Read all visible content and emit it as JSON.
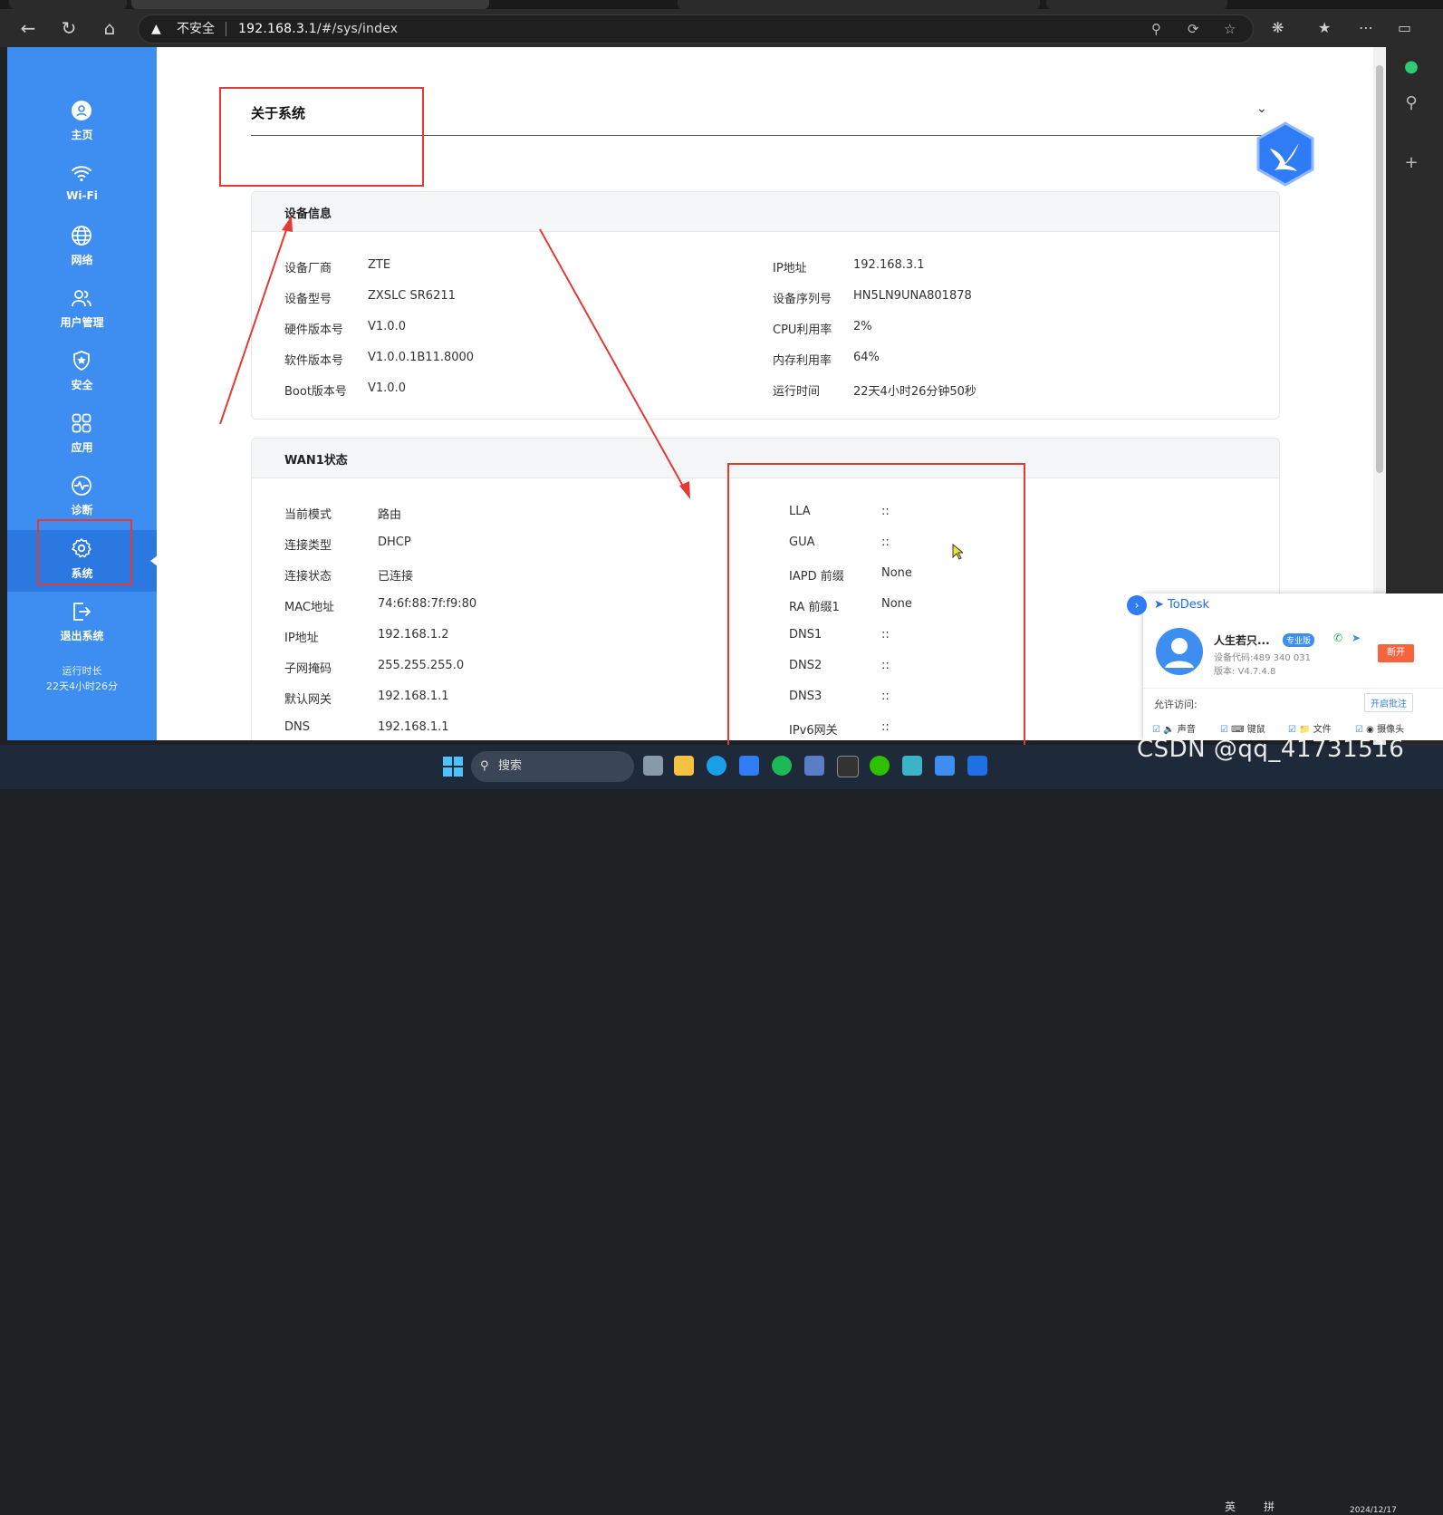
{
  "browser": {
    "security_label": "不安全",
    "url_host": "192.168.3.1",
    "url_path": "/#/sys/index"
  },
  "sidebar": {
    "items": [
      {
        "label": "主页",
        "icon": "user-circle-icon"
      },
      {
        "label": "Wi-Fi",
        "icon": "wifi-icon"
      },
      {
        "label": "网络",
        "icon": "globe-icon"
      },
      {
        "label": "用户管理",
        "icon": "users-icon"
      },
      {
        "label": "安全",
        "icon": "shield-icon"
      },
      {
        "label": "应用",
        "icon": "apps-grid-icon"
      },
      {
        "label": "诊断",
        "icon": "pulse-icon"
      },
      {
        "label": "系统",
        "icon": "gear-icon"
      },
      {
        "label": "退出系统",
        "icon": "logout-icon"
      }
    ],
    "uptime_label": "运行时长",
    "uptime_value": "22天4小时26分"
  },
  "page": {
    "title": "关于系统"
  },
  "device_info": {
    "title": "设备信息",
    "left": [
      {
        "k": "设备厂商",
        "v": "ZTE"
      },
      {
        "k": "设备型号",
        "v": "ZXSLC SR6211"
      },
      {
        "k": "硬件版本号",
        "v": "V1.0.0"
      },
      {
        "k": "软件版本号",
        "v": "V1.0.0.1B11.8000"
      },
      {
        "k": "Boot版本号",
        "v": "V1.0.0"
      }
    ],
    "right": [
      {
        "k": "IP地址",
        "v": "192.168.3.1"
      },
      {
        "k": "设备序列号",
        "v": "HN5LN9UNA801878"
      },
      {
        "k": "CPU利用率",
        "v": "2%"
      },
      {
        "k": "内存利用率",
        "v": "64%"
      },
      {
        "k": "运行时间",
        "v": "22天4小时26分钟50秒"
      }
    ]
  },
  "wan1": {
    "title": "WAN1状态",
    "left": [
      {
        "k": "当前模式",
        "v": "路由"
      },
      {
        "k": "连接类型",
        "v": "DHCP"
      },
      {
        "k": "连接状态",
        "v": "已连接"
      },
      {
        "k": "MAC地址",
        "v": "74:6f:88:7f:f9:80"
      },
      {
        "k": "IP地址",
        "v": "192.168.1.2"
      },
      {
        "k": "子网掩码",
        "v": "255.255.255.0"
      },
      {
        "k": "默认网关",
        "v": "192.168.1.1"
      },
      {
        "k": "DNS",
        "v": "192.168.1.1"
      }
    ],
    "right": [
      {
        "k": "LLA",
        "v": "::"
      },
      {
        "k": "GUA",
        "v": "::"
      },
      {
        "k": "IAPD 前缀",
        "v": "None"
      },
      {
        "k": "RA 前缀1",
        "v": "None"
      },
      {
        "k": "DNS1",
        "v": "::"
      },
      {
        "k": "DNS2",
        "v": "::"
      },
      {
        "k": "DNS3",
        "v": "::"
      },
      {
        "k": "IPv6网关",
        "v": "::"
      }
    ]
  },
  "todesk": {
    "brand": "ToDesk",
    "user": "人生若只...",
    "badge": "专业版",
    "device_code": "设备代码:489 340 031",
    "version": "版本: V4.7.4.8",
    "disconnect": "断开",
    "allow_label": "允许访问:",
    "review_button": "开启批注",
    "options": [
      "声音",
      "键鼠",
      "文件",
      "摄像头"
    ]
  },
  "taskbar": {
    "search_placeholder": "搜索",
    "date": "2024/12/17",
    "ime": "英",
    "ime2": "拼"
  },
  "watermark": "CSDN @qq_41731516",
  "colors": {
    "sidebar": "#3d8ef0",
    "sidebar_active": "#2a78e0",
    "annotation_red": "#e53935"
  }
}
